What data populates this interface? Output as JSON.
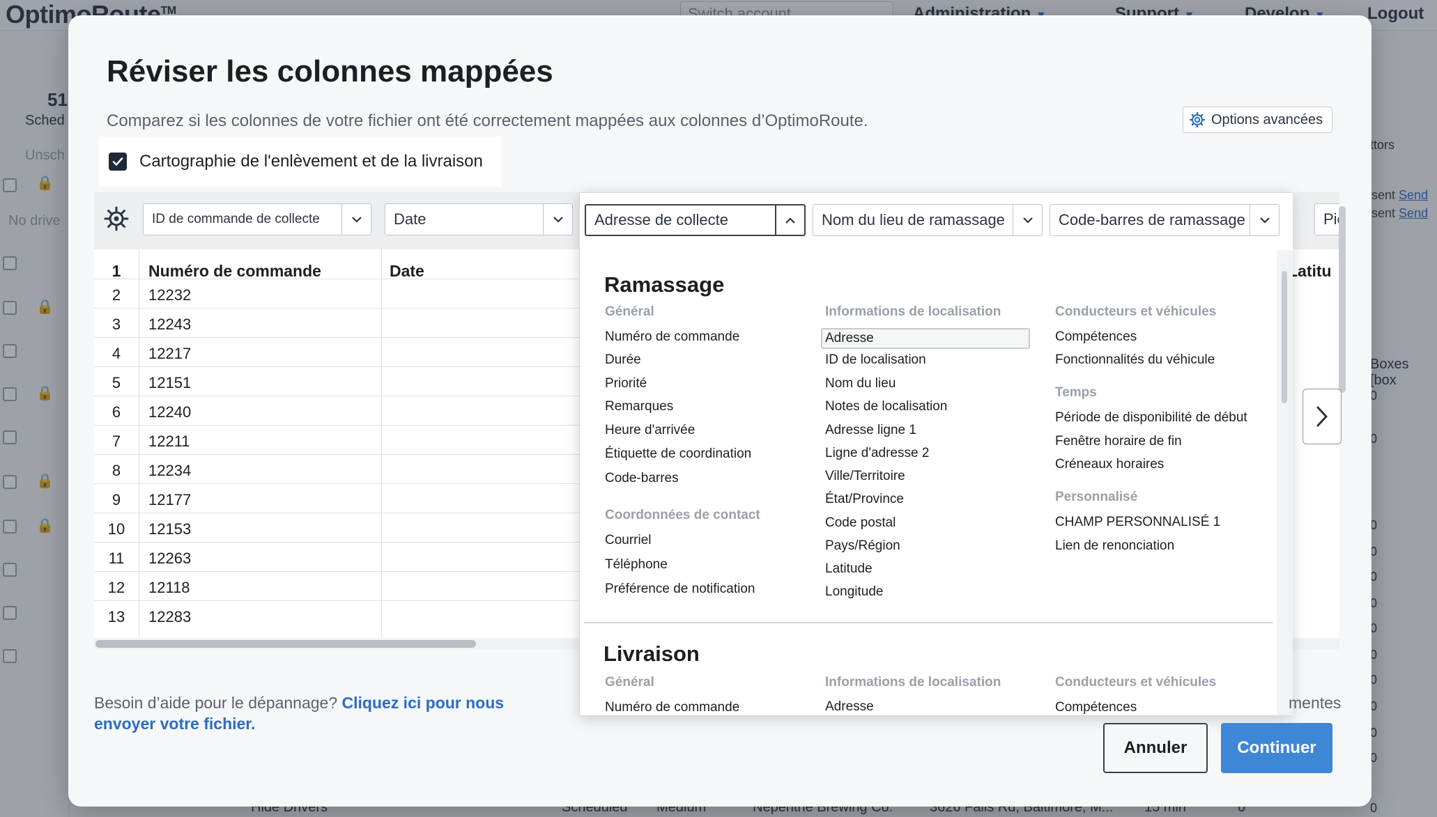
{
  "background": {
    "logo": "OptimoRoute",
    "logo_tm": "TM",
    "switch_account_placeholder": "Switch account",
    "nav": [
      "Administration",
      "Support",
      "Develop",
      "Logout"
    ],
    "scheduled_count": "51",
    "scheduled_label": "Sched",
    "unscheduled_label": "Unsch",
    "no_drivers_label": "No drive",
    "sent_label": "sent",
    "send_link": "Send",
    "tors_label": "ttors",
    "boxes_label": "Boxes [box",
    "zero_value": "0",
    "bottom_row": {
      "hide_drivers": "Hide Drivers",
      "status": "Scheduled",
      "priority": "Medium",
      "location": "Nepenthe Brewing Co.",
      "address": "3626 Falls Rd, Baltimore, M...",
      "duration": "15 min",
      "count": "0"
    }
  },
  "modal": {
    "title": "Réviser les colonnes mappées",
    "subtitle": "Comparez si les colonnes de votre fichier ont été correctement mappées aux colonnes d’OptimoRoute.",
    "advanced_options": "Options avancées",
    "mapping_checkbox_label": "Cartographie de l'enlèvement et de la livraison",
    "mapping_checkbox_checked": true,
    "column_selects": [
      "ID de commande de collecte",
      "Date",
      "Adresse de collecte",
      "Nom du lieu de ramassage",
      "Code-barres de ramassage",
      "Picku"
    ],
    "column_headers": [
      "Numéro de commande",
      "Date",
      "Latitu"
    ],
    "header_row_number": "1",
    "rows": [
      {
        "n": "2",
        "order": "12232"
      },
      {
        "n": "3",
        "order": "12243"
      },
      {
        "n": "4",
        "order": "12217"
      },
      {
        "n": "5",
        "order": "12151"
      },
      {
        "n": "6",
        "order": "12240"
      },
      {
        "n": "7",
        "order": "12211"
      },
      {
        "n": "8",
        "order": "12234"
      },
      {
        "n": "9",
        "order": "12177"
      },
      {
        "n": "10",
        "order": "12153"
      },
      {
        "n": "11",
        "order": "12263"
      },
      {
        "n": "12",
        "order": "12118"
      },
      {
        "n": "13",
        "order": "12283"
      }
    ],
    "dropdown": {
      "pickup": {
        "title": "Ramassage",
        "general_title": "Général",
        "general": [
          "Numéro de commande",
          "Durée",
          "Priorité",
          "Remarques",
          "Heure d'arrivée",
          "Étiquette de coordination",
          "Code-barres"
        ],
        "contact_title": "Coordonnées de contact",
        "contact": [
          "Courriel",
          "Téléphone",
          "Préférence de notification"
        ],
        "location_title": "Informations de localisation",
        "location": [
          "Adresse",
          "ID de localisation",
          "Nom du lieu",
          "Notes de localisation",
          "Adresse ligne 1",
          "Ligne d'adresse 2",
          "Ville/Territoire",
          "État/Province",
          "Code postal",
          "Pays/Région",
          "Latitude",
          "Longitude"
        ],
        "drivers_title": "Conducteurs et véhicules",
        "drivers": [
          "Compétences",
          "Fonctionnalités du véhicule"
        ],
        "time_title": "Temps",
        "time": [
          "Période de disponibilité de début",
          "Fenêtre horaire de fin",
          "Créneaux horaires"
        ],
        "custom_title": "Personnalisé",
        "custom": [
          "CHAMP PERSONNALISÉ 1",
          "Lien de renonciation"
        ]
      },
      "delivery": {
        "title": "Livraison",
        "general_title": "Général",
        "general": [
          "Numéro de commande"
        ],
        "location_title": "Informations de localisation",
        "location": [
          "Adresse"
        ],
        "drivers_title": "Conducteurs et véhicules",
        "drivers": [
          "Compétences"
        ]
      }
    },
    "help_text": "Besoin d’aide pour le dépannage?",
    "help_link": "Cliquez ici pour nous envoyer votre fichier.",
    "right_partial": "mentes",
    "cancel_label": "Annuler",
    "continue_label": "Continuer"
  },
  "colors": {
    "accent": "#3e86d6",
    "link": "#2b6cc4",
    "checkbox": "#1e2a38"
  }
}
